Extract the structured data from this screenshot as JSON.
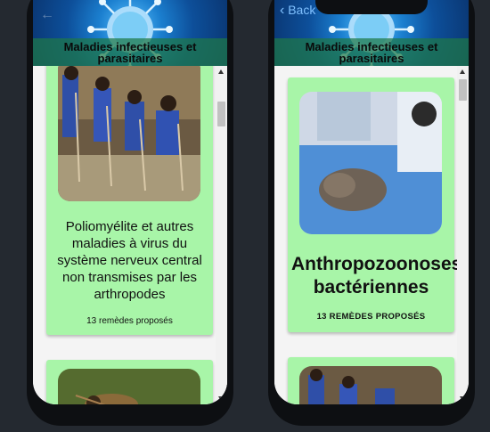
{
  "left_screen": {
    "header_title": "Maladies infectieuses et parasitaires",
    "cards": [
      {
        "title": "Poliomyélite et autres maladies à virus du système nerveux central non transmises par les arthropodes",
        "count": "13 remèdes proposés"
      }
    ]
  },
  "right_screen": {
    "back_label": "Back",
    "header_title": "Maladies infectieuses et parasitaires",
    "cards": [
      {
        "title": "Anthropozoonoses bactériennes",
        "count": "13 REMÈDES PROPOSÉS"
      }
    ]
  },
  "icons": [
    "virus-banner",
    "chevron-left-icon",
    "scroll-up-icon",
    "scroll-down-icon"
  ],
  "colors": {
    "card_bg": "#a8f5a8",
    "header_band": "#1e7846",
    "page_bg": "#242930",
    "back_link": "#7fc0ff"
  }
}
